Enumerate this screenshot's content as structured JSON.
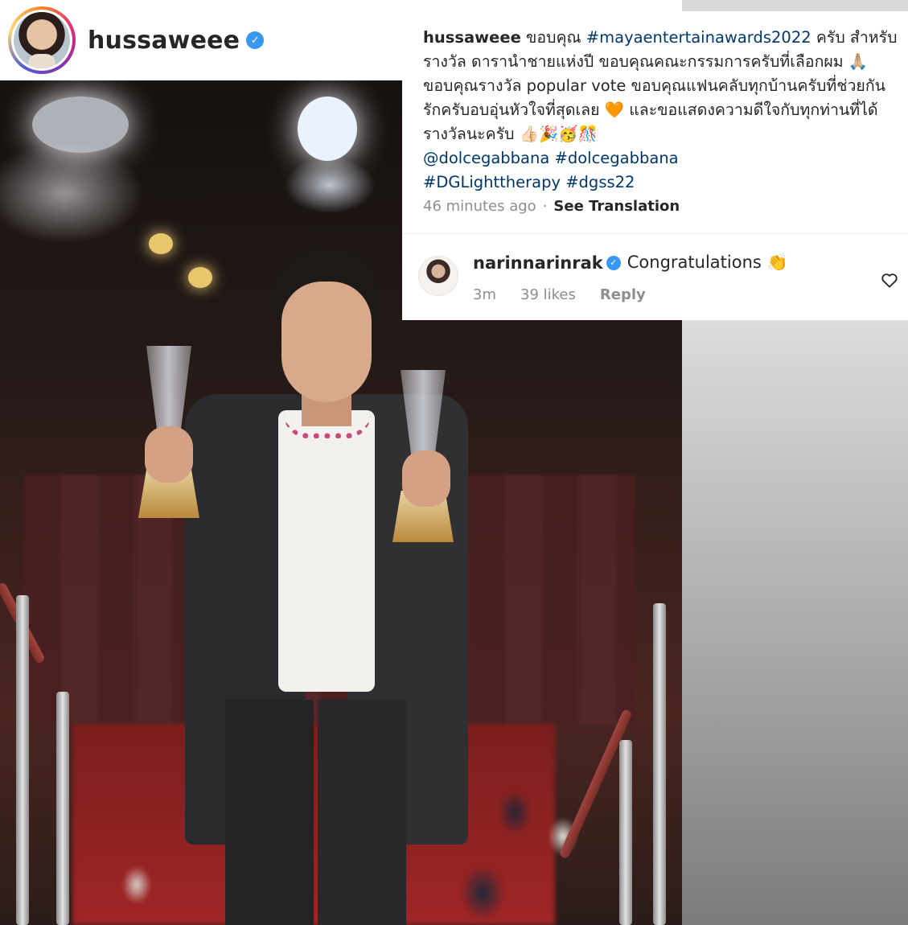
{
  "post": {
    "owner_username": "hussaweee",
    "verified": true
  },
  "caption": {
    "username": "hussaweee",
    "text_1": " ขอบคุณ ",
    "hashtag_1": "#mayaentertainawards2022",
    "text_2": "  ครับ สำหรับรางวัล ดารานำชายแห่งปี ขอบคุณคณะกรรมการครับที่เลือกผม 🙏🏼  ขอบคุณรางวัล popular vote ขอบคุณแฟนคลับทุกบ้านครับที่ช่วยกัน รักครับอบอุ่นหัวใจที่สุดเลย 🧡 และขอแสดงความดีใจกับทุกท่านที่ได้รางวัลนะครับ 👍🏻🎉🥳🎊",
    "mention": "@dolcegabbana",
    "hashtag_2": "#dolcegabbana",
    "hashtag_3": "#DGLighttherapy",
    "hashtag_4": "#dgss22",
    "time_ago": "46 minutes ago",
    "separator": "·",
    "see_translation": "See Translation"
  },
  "comment": {
    "username": "narinnarinrak",
    "verified": true,
    "text": "Congratulations 👏",
    "age": "3m",
    "likes": "39 likes",
    "reply_label": "Reply"
  },
  "icons": {
    "verified": "verified-check-icon",
    "like": "heart-outline-icon"
  },
  "colors": {
    "verified_blue": "#3897f0",
    "hashtag": "#00376b",
    "meta_gray": "#8e8e8e",
    "text": "#262626"
  }
}
